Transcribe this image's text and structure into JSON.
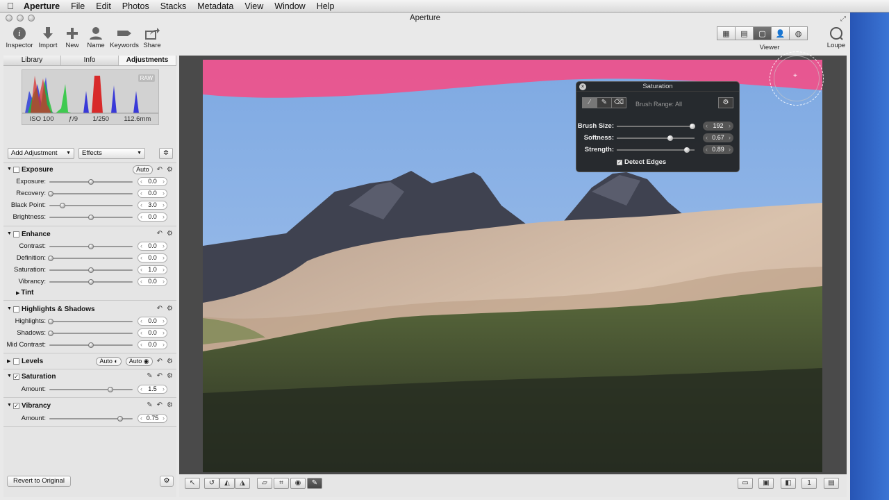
{
  "menubar": {
    "app_name": "Aperture",
    "items": [
      "File",
      "Edit",
      "Photos",
      "Stacks",
      "Metadata",
      "View",
      "Window",
      "Help"
    ]
  },
  "window": {
    "title": "Aperture"
  },
  "toolbar": {
    "left": [
      {
        "label": "Inspector",
        "icon": "info-icon"
      },
      {
        "label": "Import",
        "icon": "import-arrow-icon"
      },
      {
        "label": "New",
        "icon": "plus-icon"
      },
      {
        "label": "Name",
        "icon": "person-icon"
      },
      {
        "label": "Keywords",
        "icon": "tag-icon"
      },
      {
        "label": "Share",
        "icon": "share-icon"
      }
    ],
    "viewer_label": "Viewer",
    "loupe_label": "Loupe"
  },
  "inspector": {
    "tabs": [
      "Library",
      "Info",
      "Adjustments"
    ],
    "active_tab": "Adjustments",
    "histogram": {
      "badge": "RAW",
      "iso": "ISO 100",
      "aperture": "ƒ/9",
      "shutter": "1/250",
      "focal": "112.6mm"
    },
    "add_adjustment": "Add Adjustment",
    "effects": "Effects",
    "sections": {
      "exposure": {
        "title": "Exposure",
        "auto": "Auto",
        "rows": [
          {
            "label": "Exposure:",
            "value": "0.0"
          },
          {
            "label": "Recovery:",
            "value": "0.0"
          },
          {
            "label": "Black Point:",
            "value": "3.0"
          },
          {
            "label": "Brightness:",
            "value": "0.0"
          }
        ]
      },
      "enhance": {
        "title": "Enhance",
        "rows": [
          {
            "label": "Contrast:",
            "value": "0.0"
          },
          {
            "label": "Definition:",
            "value": "0.0"
          },
          {
            "label": "Saturation:",
            "value": "1.0"
          },
          {
            "label": "Vibrancy:",
            "value": "0.0"
          }
        ],
        "tint": "Tint"
      },
      "highlights": {
        "title": "Highlights & Shadows",
        "rows": [
          {
            "label": "Highlights:",
            "value": "0.0"
          },
          {
            "label": "Shadows:",
            "value": "0.0"
          },
          {
            "label": "Mid Contrast:",
            "value": "0.0"
          }
        ]
      },
      "levels": {
        "title": "Levels",
        "auto1": "Auto",
        "auto2": "Auto"
      },
      "saturation": {
        "title": "Saturation",
        "rows": [
          {
            "label": "Amount:",
            "value": "1.5"
          }
        ]
      },
      "vibrancy": {
        "title": "Vibrancy",
        "rows": [
          {
            "label": "Amount:",
            "value": "0.75"
          }
        ]
      }
    },
    "revert": "Revert to Original"
  },
  "hud": {
    "title": "Saturation",
    "brush_range": "Brush Range: All",
    "rows": [
      {
        "label": "Brush Size:",
        "value": "192"
      },
      {
        "label": "Softness:",
        "value": "0.67"
      },
      {
        "label": "Strength:",
        "value": "0.89"
      }
    ],
    "detect_edges": "Detect Edges"
  },
  "colors": {
    "sky": "#8fb6e6",
    "brush_overlay": "#f0508a",
    "mountain_dark": "#3f4250",
    "hillside": "#cdb49f",
    "valley": "#3d442d"
  }
}
